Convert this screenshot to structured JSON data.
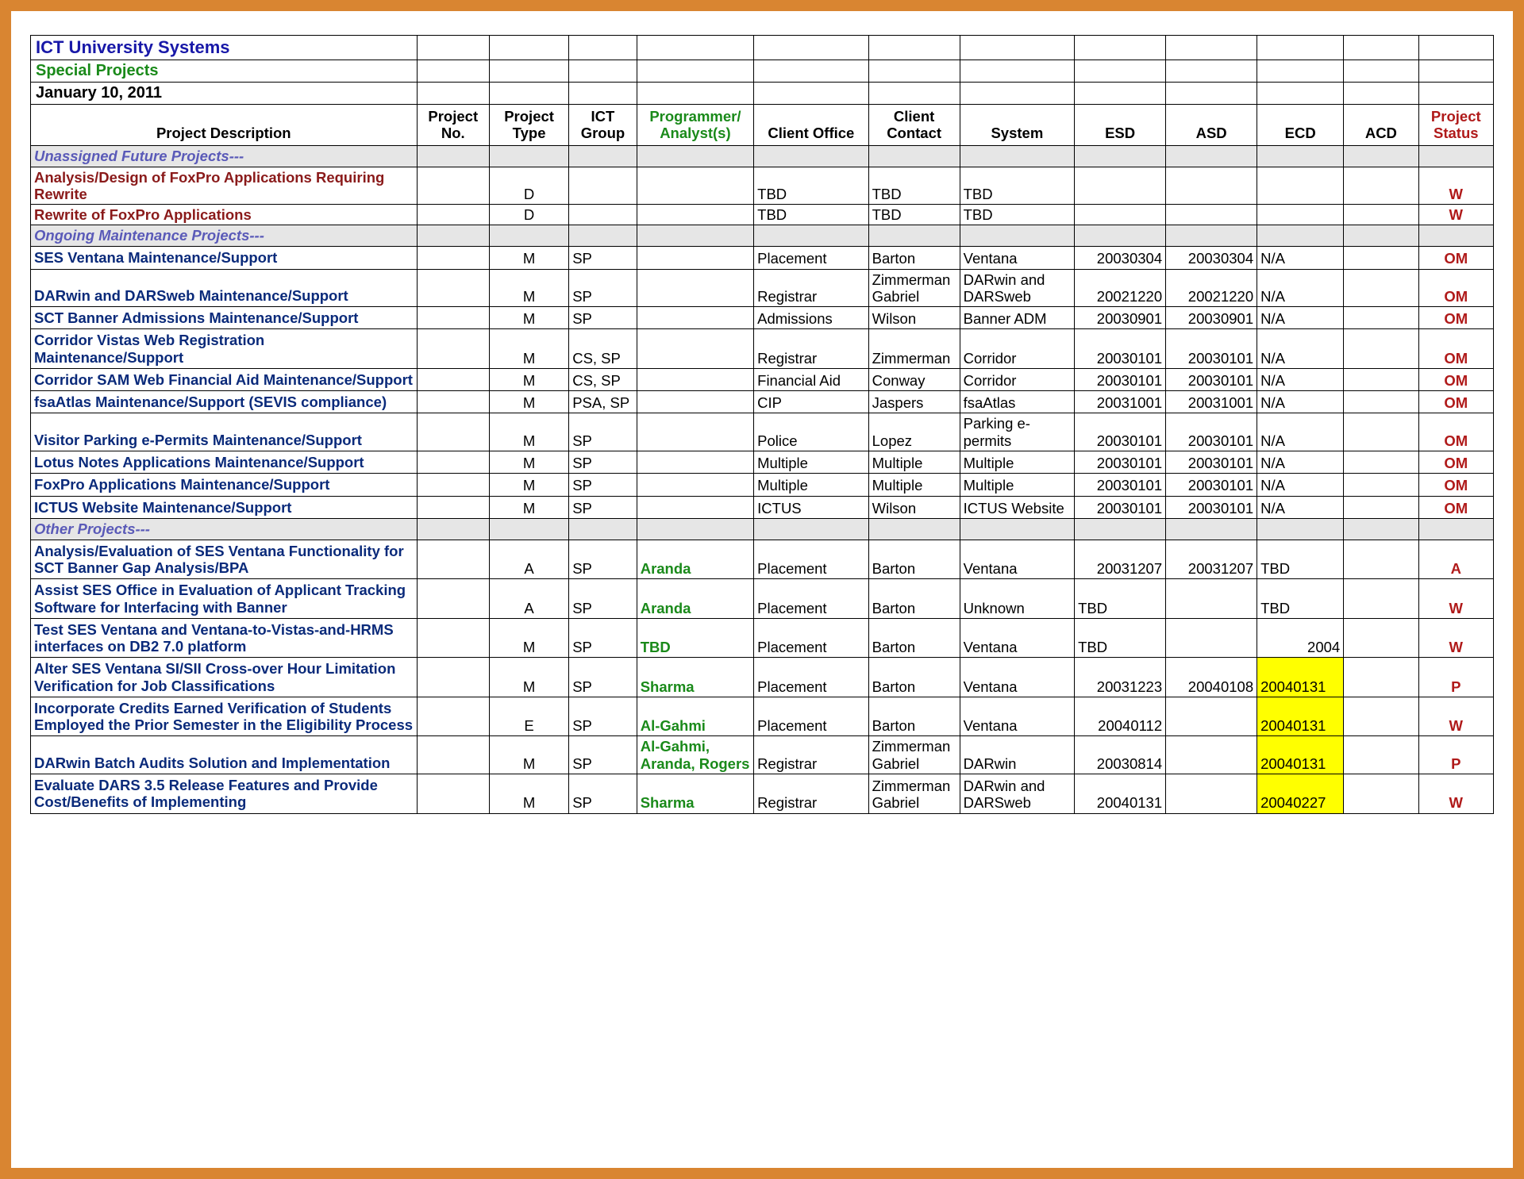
{
  "titles": {
    "line1": "ICT University Systems",
    "line2": "Special Projects",
    "line3": "January 10, 2011"
  },
  "headers": {
    "desc": "Project Description",
    "pno": "Project No.",
    "ptype": "Project Type",
    "grp": "ICT Group",
    "prog": "Programmer/ Analyst(s)",
    "office": "Client Office",
    "contact": "Client Contact",
    "system": "System",
    "esd": "ESD",
    "asd": "ASD",
    "ecd": "ECD",
    "acd": "ACD",
    "status": "Project Status"
  },
  "sections": {
    "s1": "Unassigned Future Projects---",
    "s2": "Ongoing Maintenance Projects---",
    "s3": "Other Projects---"
  },
  "rows": {
    "r1": {
      "desc": "Analysis/Design of FoxPro Applications Requiring Rewrite",
      "ptype": "D",
      "grp": "",
      "prog": "",
      "office": "TBD",
      "contact": "TBD",
      "system": "TBD",
      "esd": "",
      "asd": "",
      "ecd": "",
      "acd": "",
      "status": "W"
    },
    "r2": {
      "desc": "Rewrite of FoxPro Applications",
      "ptype": "D",
      "grp": "",
      "prog": "",
      "office": "TBD",
      "contact": "TBD",
      "system": "TBD",
      "esd": "",
      "asd": "",
      "ecd": "",
      "acd": "",
      "status": "W"
    },
    "r3": {
      "desc": "SES Ventana Maintenance/Support",
      "ptype": "M",
      "grp": "SP",
      "prog": "",
      "office": "Placement",
      "contact": "Barton",
      "system": "Ventana",
      "esd": "20030304",
      "asd": "20030304",
      "ecd": "N/A",
      "acd": "",
      "status": "OM"
    },
    "r4": {
      "desc": "DARwin and DARSweb Maintenance/Support",
      "ptype": "M",
      "grp": "SP",
      "prog": "",
      "office": "Registrar",
      "contact": "Zimmerman Gabriel",
      "system": "DARwin and DARSweb",
      "esd": "20021220",
      "asd": "20021220",
      "ecd": "N/A",
      "acd": "",
      "status": "OM"
    },
    "r5": {
      "desc": "SCT Banner Admissions Maintenance/Support",
      "ptype": "M",
      "grp": "SP",
      "prog": "",
      "office": "Admissions",
      "contact": "Wilson",
      "system": "Banner ADM",
      "esd": "20030901",
      "asd": "20030901",
      "ecd": "N/A",
      "acd": "",
      "status": "OM"
    },
    "r6": {
      "desc": "Corridor Vistas Web Registration Maintenance/Support",
      "ptype": "M",
      "grp": "CS, SP",
      "prog": "",
      "office": "Registrar",
      "contact": "Zimmerman",
      "system": "Corridor",
      "esd": "20030101",
      "asd": "20030101",
      "ecd": "N/A",
      "acd": "",
      "status": "OM"
    },
    "r7": {
      "desc": "Corridor SAM Web Financial Aid Maintenance/Support",
      "ptype": "M",
      "grp": "CS, SP",
      "prog": "",
      "office": "Financial Aid",
      "contact": "Conway",
      "system": "Corridor",
      "esd": "20030101",
      "asd": "20030101",
      "ecd": "N/A",
      "acd": "",
      "status": "OM"
    },
    "r8": {
      "desc": "fsaAtlas Maintenance/Support (SEVIS compliance)",
      "ptype": "M",
      "grp": "PSA, SP",
      "prog": "",
      "office": "CIP",
      "contact": "Jaspers",
      "system": "fsaAtlas",
      "esd": "20031001",
      "asd": "20031001",
      "ecd": "N/A",
      "acd": "",
      "status": "OM"
    },
    "r9": {
      "desc": "Visitor Parking e-Permits Maintenance/Support",
      "ptype": "M",
      "grp": "SP",
      "prog": "",
      "office": "Police",
      "contact": "Lopez",
      "system": "Parking e-permits",
      "esd": "20030101",
      "asd": "20030101",
      "ecd": "N/A",
      "acd": "",
      "status": "OM"
    },
    "r10": {
      "desc": "Lotus Notes Applications Maintenance/Support",
      "ptype": "M",
      "grp": "SP",
      "prog": "",
      "office": "Multiple",
      "contact": "Multiple",
      "system": "Multiple",
      "esd": "20030101",
      "asd": "20030101",
      "ecd": "N/A",
      "acd": "",
      "status": "OM"
    },
    "r11": {
      "desc": "FoxPro Applications Maintenance/Support",
      "ptype": "M",
      "grp": "SP",
      "prog": "",
      "office": "Multiple",
      "contact": "Multiple",
      "system": "Multiple",
      "esd": "20030101",
      "asd": "20030101",
      "ecd": "N/A",
      "acd": "",
      "status": "OM"
    },
    "r12": {
      "desc": "ICTUS Website Maintenance/Support",
      "ptype": "M",
      "grp": "SP",
      "prog": "",
      "office": "ICTUS",
      "contact": "Wilson",
      "system": "ICTUS Website",
      "esd": "20030101",
      "asd": "20030101",
      "ecd": "N/A",
      "acd": "",
      "status": "OM"
    },
    "r13": {
      "desc": "Analysis/Evaluation of SES Ventana Functionality for SCT Banner Gap Analysis/BPA",
      "ptype": "A",
      "grp": "SP",
      "prog": "Aranda",
      "office": "Placement",
      "contact": "Barton",
      "system": "Ventana",
      "esd": "20031207",
      "asd": "20031207",
      "ecd": "TBD",
      "acd": "",
      "status": "A"
    },
    "r14": {
      "desc": "Assist SES Office in Evaluation of Applicant Tracking Software for Interfacing with Banner",
      "ptype": "A",
      "grp": "SP",
      "prog": "Aranda",
      "office": "Placement",
      "contact": "Barton",
      "system": "Unknown",
      "esd": "TBD",
      "asd": "",
      "ecd": "TBD",
      "acd": "",
      "status": "W"
    },
    "r15": {
      "desc": "Test SES Ventana and Ventana-to-Vistas-and-HRMS interfaces on DB2 7.0 platform",
      "ptype": "M",
      "grp": "SP",
      "prog": "TBD",
      "office": "Placement",
      "contact": "Barton",
      "system": "Ventana",
      "esd": "TBD",
      "asd": "",
      "ecd": "2004",
      "acd": "",
      "status": "W"
    },
    "r16": {
      "desc": "Alter SES Ventana SI/SII Cross-over Hour Limitation Verification for Job Classifications",
      "ptype": "M",
      "grp": "SP",
      "prog": "Sharma",
      "office": "Placement",
      "contact": "Barton",
      "system": "Ventana",
      "esd": "20031223",
      "asd": "20040108",
      "ecd": "20040131",
      "acd": "",
      "status": "P"
    },
    "r17": {
      "desc": "Incorporate Credits Earned Verification of Students Employed the Prior Semester in the Eligibility Process",
      "ptype": "E",
      "grp": "SP",
      "prog": "Al-Gahmi",
      "office": "Placement",
      "contact": "Barton",
      "system": "Ventana",
      "esd": "20040112",
      "asd": "",
      "ecd": "20040131",
      "acd": "",
      "status": "W"
    },
    "r18": {
      "desc": "DARwin Batch Audits Solution and Implementation",
      "ptype": "M",
      "grp": "SP",
      "prog": "Al-Gahmi, Aranda, Rogers",
      "office": "Registrar",
      "contact": "Zimmerman Gabriel",
      "system": "DARwin",
      "esd": "20030814",
      "asd": "",
      "ecd": "20040131",
      "acd": "",
      "status": "P"
    },
    "r19": {
      "desc": "Evaluate DARS 3.5 Release Features and Provide Cost/Benefits of Implementing",
      "ptype": "M",
      "grp": "SP",
      "prog": "Sharma",
      "office": "Registrar",
      "contact": "Zimmerman Gabriel",
      "system": "DARwin and DARSweb",
      "esd": "20040131",
      "asd": "",
      "ecd": "20040227",
      "acd": "",
      "status": "W"
    }
  }
}
